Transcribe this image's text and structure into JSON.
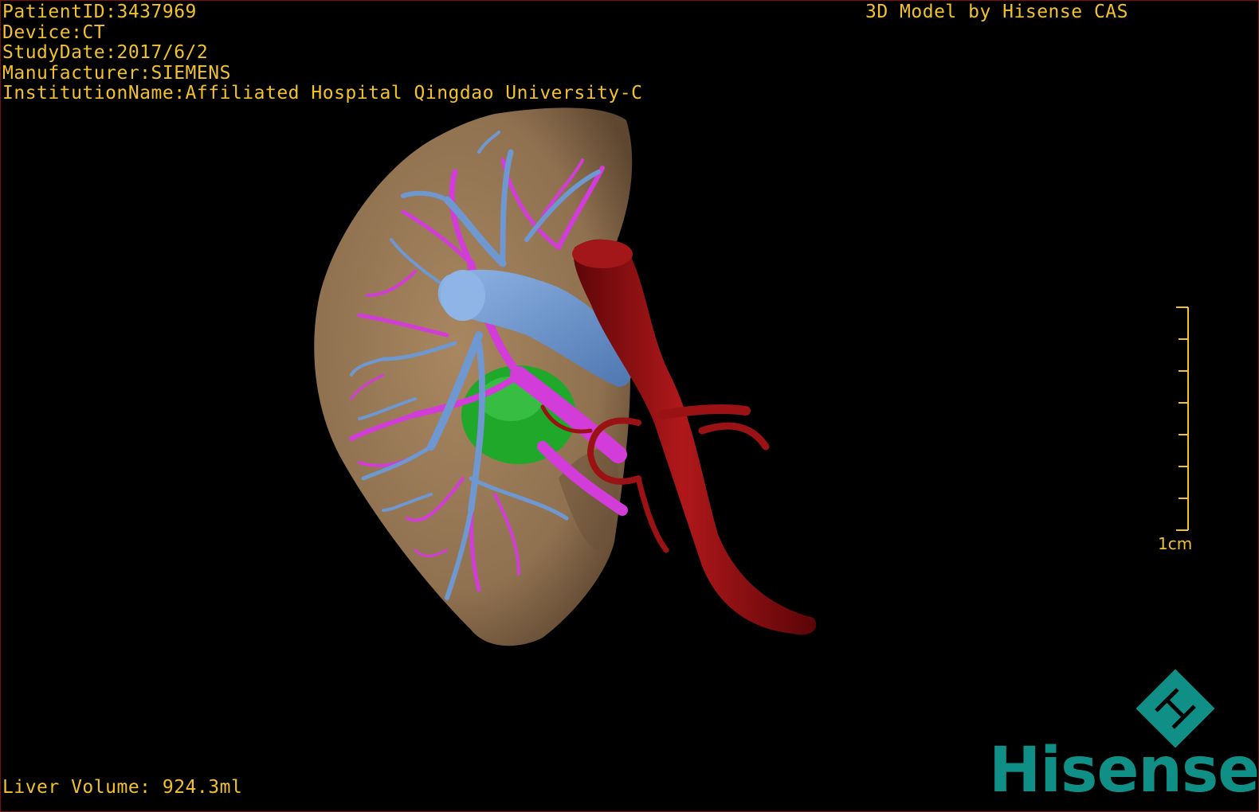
{
  "overlay": {
    "patient_id": "PatientID:3437969",
    "device": "Device:CT",
    "study_date": "StudyDate:2017/6/2",
    "manufacturer": "Manufacturer:SIEMENS",
    "institution": "InstitutionName:Affiliated Hospital Qingdao University-C",
    "credit": "3D Model by Hisense CAS",
    "volume": "Liver Volume: 924.3ml"
  },
  "scale": {
    "label": "1cm"
  },
  "logo": {
    "brand": "Hisense",
    "mark_icon": "hisense-diamond-logo-icon"
  },
  "colors": {
    "text": "#f2c12e",
    "liver": "#9c7c55",
    "portal_vein": "#6f97d0",
    "hepatic_vessels": "#d23cd8",
    "gallbladder": "#1fa82a",
    "artery": "#9b1215",
    "brand": "#0f8f86",
    "frame": "#7a1010"
  }
}
